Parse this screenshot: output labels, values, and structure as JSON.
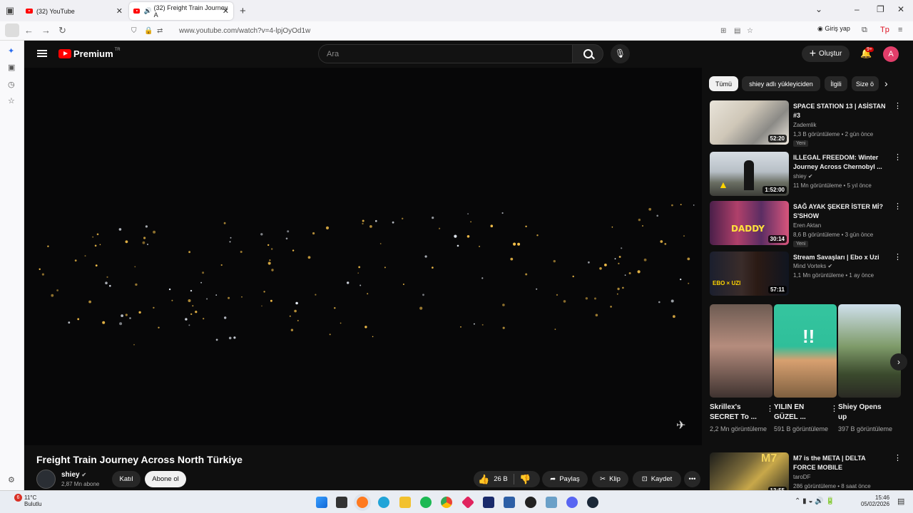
{
  "browser": {
    "tabs": [
      {
        "title": "(32) YouTube"
      },
      {
        "title": "(32) Freight Train Journey A"
      }
    ],
    "url": "www.youtube.com/watch?v=4-lpjOyOd1w",
    "signin_label": "Giriş yap"
  },
  "youtube": {
    "premium_label": "Premium",
    "region": "TR",
    "search_placeholder": "Ara",
    "create_label": "Oluştur",
    "notification_count": "9+",
    "avatar_letter": "A"
  },
  "video": {
    "title": "Freight Train Journey Across North Türkiye",
    "channel": "shiey",
    "subscribers": "2,87 Mn abone",
    "join_label": "Katıl",
    "subscribe_label": "Abone ol",
    "likes": "26 B",
    "share_label": "Paylaş",
    "clip_label": "Klip",
    "save_label": "Kaydet"
  },
  "chips": [
    "Tümü",
    "shiey adlı yükleyiciden",
    "İlgili",
    "Size ö"
  ],
  "recommended": [
    {
      "title": "SPACE STATION 13 | ASİSTAN #3",
      "channel": "Zademlik",
      "meta": "1,3 B görüntüleme • 2 gün önce",
      "duration": "52:20",
      "badge": "Yeni"
    },
    {
      "title": "ILLEGAL FREEDOM: Winter Journey Across Chernobyl ...",
      "channel": "shiey",
      "meta": "11 Mn görüntüleme • 5 yıl önce",
      "duration": "1:52:00"
    },
    {
      "title": "SAĞ AYAK ŞEKER İSTER Mİ? S'SHOW",
      "channel": "Eren Aktan",
      "meta": "8,6 B görüntüleme • 3 gün önce",
      "duration": "30:14",
      "badge": "Yeni"
    },
    {
      "title": "Stream Savaşları | Ebo x Uzi",
      "channel": "Mind Vorteks",
      "meta": "1,1 Mn görüntüleme • 1 ay önce",
      "duration": "57:11"
    },
    {
      "title": "M7 is the META | DELTA FORCE MOBILE",
      "channel": "taroDF",
      "meta": "286 görüntüleme • 8 saat önce",
      "duration": "13:55"
    }
  ],
  "shorts": [
    {
      "title": "Skrillex's SECRET To ...",
      "views": "2,2 Mn görüntüleme"
    },
    {
      "title": "YILIN EN GÜZEL ...",
      "views": "591 B görüntüleme"
    },
    {
      "title": "Shiey Opens up",
      "views": "397 B görüntüleme"
    }
  ],
  "taskbar": {
    "weather_temp": "11°C",
    "weather_desc": "Bulutlu",
    "weather_badge": "6",
    "time": "15:46",
    "date": "05/02/2026"
  },
  "colors": {
    "yt_red": "#ff0000",
    "bg": "#0f0f0f",
    "avatar": "#e23e6a"
  }
}
